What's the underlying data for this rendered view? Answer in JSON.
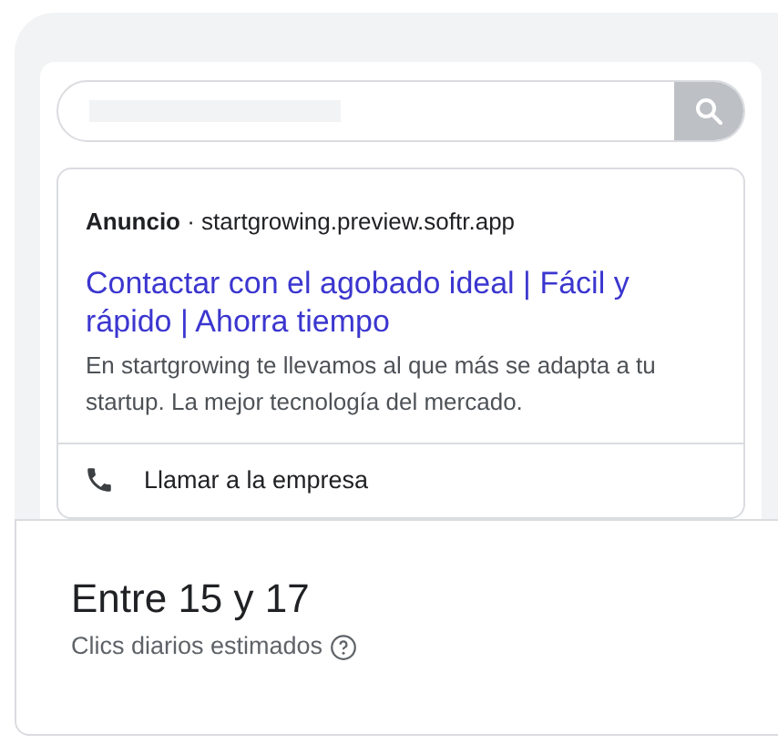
{
  "search": {
    "kind": "skeleton"
  },
  "ad": {
    "label": "Anuncio",
    "separator": "·",
    "domain": "startgrowing.preview.softr.app",
    "title": "Contactar con el agobado ideal | Fácil y rápido | Ahorra tiempo",
    "description": "En startgrowing te llevamos al que más se adapta a tu startup. La mejor tecnología del mercado.",
    "extension": "Llamar a la empresa"
  },
  "estimate": {
    "value": "Entre 15 y 17",
    "label": "Clics diarios estimados"
  }
}
